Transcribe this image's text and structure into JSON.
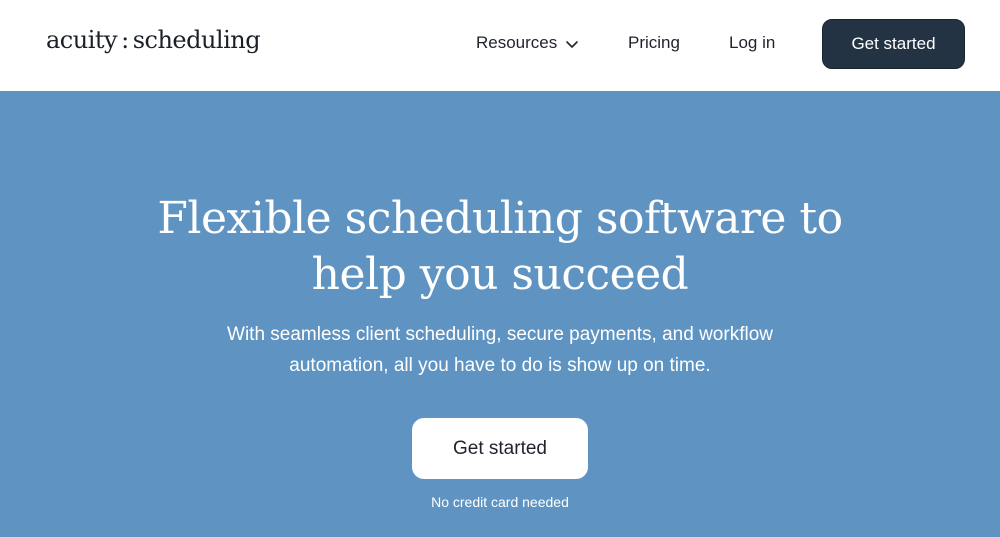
{
  "header": {
    "logo_left": "acuity",
    "logo_sep": ":",
    "logo_right": "scheduling",
    "nav": {
      "resources": "Resources",
      "pricing": "Pricing",
      "login": "Log in"
    },
    "cta": "Get started"
  },
  "hero": {
    "headline_line1": "Flexible scheduling software to",
    "headline_line2": "help you succeed",
    "subtext_line1": "With seamless client scheduling, secure payments, and workflow",
    "subtext_line2": "automation, all you have to do is show up on time.",
    "cta": "Get started",
    "note": "No credit card needed"
  },
  "colors": {
    "hero_bg": "#5f94c2",
    "header_button_bg": "#243344",
    "text_dark": "#1f232b"
  },
  "icons": {
    "resources_dropdown": "chevron-down-icon"
  }
}
